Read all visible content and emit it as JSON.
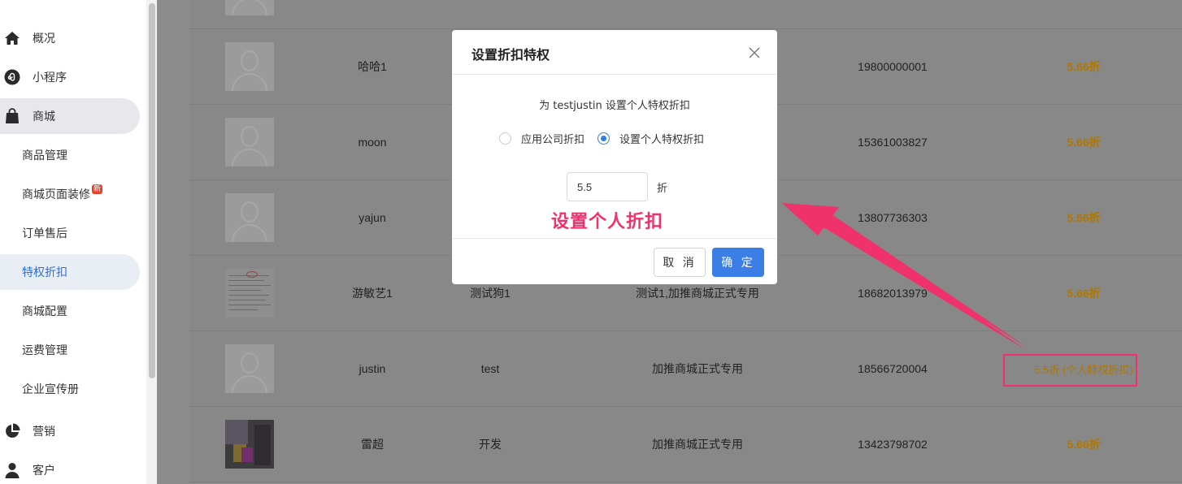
{
  "sidebar": {
    "items": [
      {
        "label": "概况",
        "icon": "home-icon"
      },
      {
        "label": "小程序",
        "icon": "mini-program-icon"
      },
      {
        "label": "商城",
        "icon": "shopping-bag-icon"
      },
      {
        "label": "营销",
        "icon": "pie-chart-icon"
      },
      {
        "label": "客户",
        "icon": "user-icon"
      }
    ],
    "sub_items": [
      {
        "label": "商品管理"
      },
      {
        "label": "商城页面装修",
        "badge": "新"
      },
      {
        "label": "订单售后"
      },
      {
        "label": "特权折扣",
        "active": true
      },
      {
        "label": "商城配置"
      },
      {
        "label": "运费管理"
      },
      {
        "label": "企业宣传册"
      }
    ]
  },
  "table": {
    "rows": [
      {
        "name": "哈哈1",
        "nickname": "",
        "company": "",
        "phone": "19800000001",
        "discount": "5.66折"
      },
      {
        "name": "moon",
        "nickname": "",
        "company": "",
        "phone": "15361003827",
        "discount": "5.66折"
      },
      {
        "name": "yajun",
        "nickname": "",
        "company": "",
        "phone": "13807736303",
        "discount": "5.66折"
      },
      {
        "name": "游敏艺1",
        "nickname": "测试狗1",
        "company": "测试1,加推商城正式专用",
        "phone": "18682013979",
        "discount": "5.66折"
      },
      {
        "name": "justin",
        "nickname": "test",
        "company": "加推商城正式专用",
        "phone": "18566720004",
        "discount": "5.5折 (个人特权折扣)"
      },
      {
        "name": "雷超",
        "nickname": "开发",
        "company": "加推商城正式专用",
        "phone": "13423798702",
        "discount": "5.66折"
      }
    ]
  },
  "modal": {
    "title": "设置折扣特权",
    "description": "为 testjustin 设置个人特权折扣",
    "option_company": "应用公司折扣",
    "option_personal": "设置个人特权折扣",
    "selected_option": "option_personal",
    "discount_value": "5.5",
    "discount_unit": "折",
    "cancel_label": "取 消",
    "ok_label": "确 定"
  },
  "annotation": {
    "text": "设置个人折扣",
    "color": "#f0326c"
  },
  "colors": {
    "primary": "#3a7ee6",
    "discount": "#b07700",
    "annotation": "#f0326c"
  }
}
